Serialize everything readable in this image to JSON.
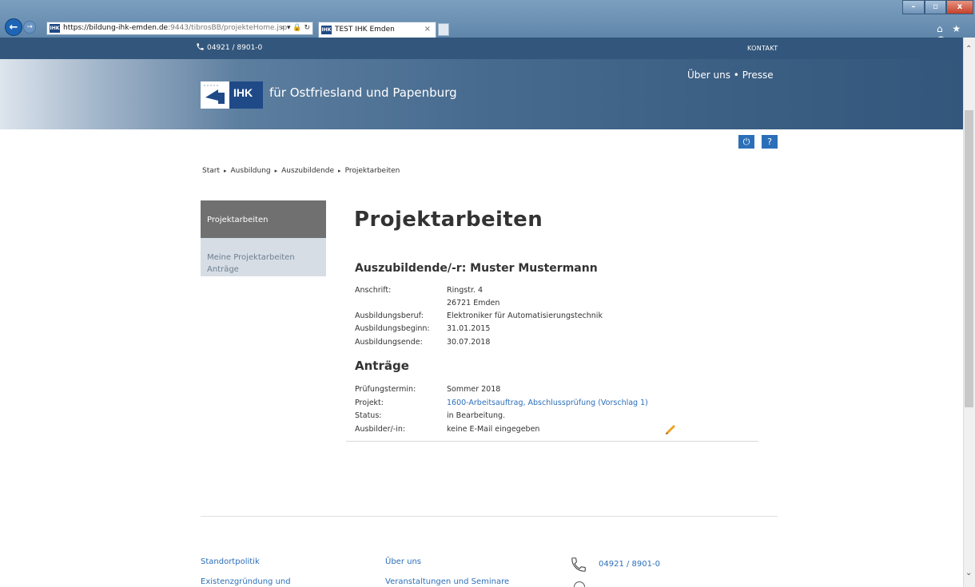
{
  "browser": {
    "url_domain": "https://bildung-ihk-emden.de",
    "url_path": ":9443/tibrosBB/projekteHome.jsp",
    "url_tools": "⌕ ▾ 🔒 ↻",
    "tab_title": "TEST IHK Emden",
    "tab_close": "×",
    "favicon_label": "IHK",
    "win_min": "–",
    "win_max": "▫",
    "win_close": "x",
    "toolbar_icons": "⌂ ★ ⚙",
    "back_arrow": "←",
    "forward_arrow": "→"
  },
  "header": {
    "phone": "04921 / 8901-0",
    "kontakt": "KONTAKT",
    "logo_text": "IHK",
    "site_title": "für Ostfriesland und Papenburg",
    "links": "Über uns • Presse"
  },
  "tools": {
    "power_icon": "⏻",
    "help_label": "?"
  },
  "breadcrumb": {
    "items": [
      "Start",
      "Ausbildung",
      "Auszubildende",
      "Projektarbeiten"
    ],
    "separator": "▸"
  },
  "sidenav": {
    "active": "Projektarbeiten",
    "items": [
      "Meine Projektarbeiten",
      "Anträge"
    ]
  },
  "main": {
    "title": "Projektarbeiten",
    "trainee_heading": "Auszubildende/-r: Muster Mustermann",
    "trainee": {
      "anschrift_label": "Anschrift:",
      "anschrift_line1": "Ringstr. 4",
      "anschrift_line2": "26721 Emden",
      "beruf_label": "Ausbildungsberuf:",
      "beruf": "Elektroniker für Automatisierungstechnik",
      "beginn_label": "Ausbildungsbeginn:",
      "beginn": "31.01.2015",
      "ende_label": "Ausbildungsende:",
      "ende": "30.07.2018"
    },
    "antraege_heading": "Anträge",
    "antrag": {
      "termin_label": "Prüfungstermin:",
      "termin": "Sommer 2018",
      "projekt_label": "Projekt:",
      "projekt": "1600-Arbeitsauftrag, Abschlussprüfung (Vorschlag 1)",
      "status_label": "Status:",
      "status": "in Bearbeitung.",
      "ausbilder_label": "Ausbilder/-in:",
      "ausbilder": "keine E-Mail eingegeben"
    }
  },
  "footer": {
    "col1": [
      "Standortpolitik",
      "Existenzgründung und"
    ],
    "col2": [
      "Über uns",
      "Veranstaltungen und Seminare"
    ],
    "phone": "04921 / 8901-0"
  },
  "colors": {
    "header_bar": "#33577c",
    "accent_blue": "#2c6fb9",
    "nav_active": "#707070",
    "nav_sub": "#d6dde4",
    "pencil": "#f0a020"
  }
}
